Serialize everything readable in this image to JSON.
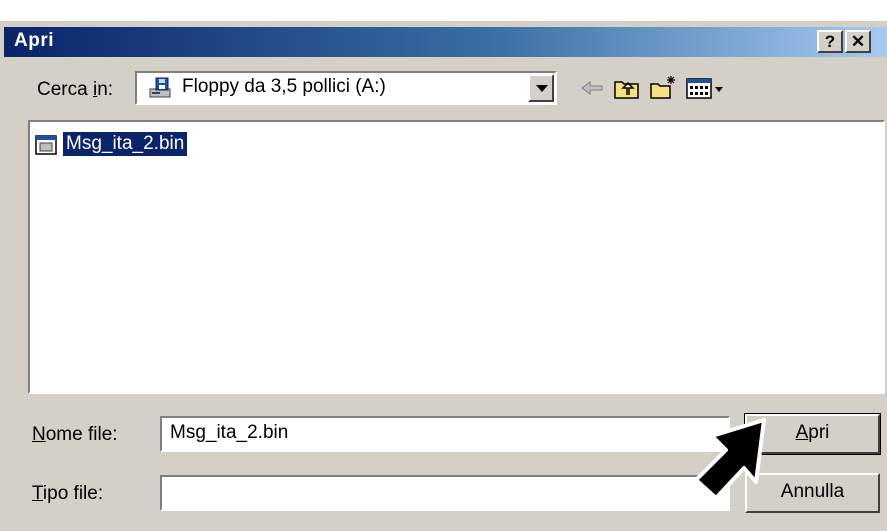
{
  "window_title": "Apri",
  "title_buttons": {
    "help": "?",
    "close": "✕"
  },
  "lookin": {
    "label_pre": "Cerca ",
    "label_accel": "i",
    "label_post": "n:",
    "location": "Floppy da 3,5 pollici (A:)",
    "location_icon": "floppy-drive-icon"
  },
  "toolbar": [
    "back-arrow-icon",
    "up-folder-icon",
    "new-folder-icon",
    "view-menu-icon"
  ],
  "files": [
    {
      "name": "Msg_ita_2.bin",
      "icon": "bin-file-icon",
      "selected": true
    }
  ],
  "filename": {
    "label_accel": "N",
    "label_rest": "ome file:",
    "value": "Msg_ita_2.bin"
  },
  "filetype": {
    "label_accel": "T",
    "label_rest": "ipo file:",
    "value": ""
  },
  "buttons": {
    "open_accel": "A",
    "open_rest": "pri",
    "cancel": "Annulla"
  },
  "colors": {
    "title_start": "#0a246a",
    "title_end": "#a6caf0",
    "face": "#d4d0c8",
    "selection": "#0a246a"
  }
}
